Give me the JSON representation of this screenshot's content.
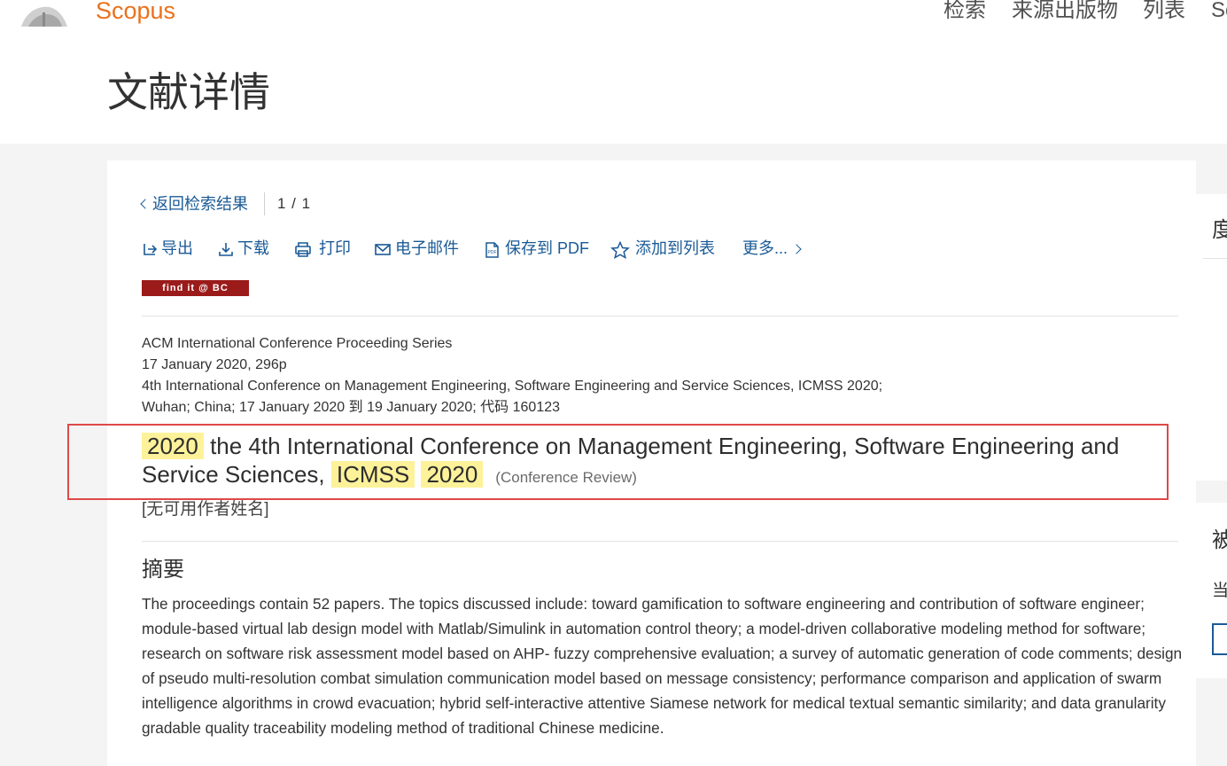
{
  "header": {
    "brand": "Scopus",
    "nav": [
      "检索",
      "来源出版物",
      "列表",
      "Sc"
    ],
    "page_title": "文献详情"
  },
  "toolbar": {
    "back_label": "返回检索结果",
    "pager": "1 / 1",
    "actions": [
      {
        "label": "导出",
        "icon": "export-icon"
      },
      {
        "label": "下载",
        "icon": "download-icon"
      },
      {
        "label": "打印",
        "icon": "print-icon"
      },
      {
        "label": "电子邮件",
        "icon": "email-icon"
      },
      {
        "label": "保存到 PDF",
        "icon": "pdf-icon"
      },
      {
        "label": "添加到列表",
        "icon": "star-icon"
      },
      {
        "label": "更多...",
        "icon": "chevron-right-icon"
      }
    ],
    "findit_label": "find it @ BC"
  },
  "document": {
    "series": "ACM International Conference Proceeding Series",
    "date_pages": "17 January 2020, 296p",
    "conference": "4th International Conference on Management Engineering, Software Engineering and Service Sciences, ICMSS 2020;",
    "location": "Wuhan; China; 17 January 2020 到 19 January 2020; 代码 160123",
    "title_parts": {
      "hl1": "2020",
      "mid1": " the 4th International Conference on Management Engineering, Software Engineering and Service Sciences, ",
      "hl2": "ICMSS",
      "hl3": "2020"
    },
    "doc_type": "(Conference Review)",
    "authors": "[无可用作者姓名]",
    "abstract_heading": "摘要",
    "abstract": "The proceedings contain 52 papers. The topics discussed include: toward gamification to software engineering and contribution of software engineer; module-based virtual lab design model with Matlab/Simulink in automation control theory; a model-driven collaborative modeling method for software; research on software risk assessment model based on AHP- fuzzy comprehensive evaluation; a survey of automatic generation of code comments; design of pseudo multi-resolution combat simulation communication model based on message consistency; performance comparison and application of swarm intelligence algorithms in crowd evacuation; hybrid self-interactive attentive Siamese network for medical textual semantic similarity; and data granularity gradable quality traceability modeling method of traditional Chinese medicine."
  },
  "sidebar": {
    "panel1_char": "度",
    "panel2_char1": "被",
    "panel2_char2": "当"
  },
  "colors": {
    "brand": "#e9711c",
    "link": "#1a5a96",
    "highlight": "#fdf29a",
    "annotation_box": "#e04848",
    "findit_bg": "#9b1b1b"
  }
}
